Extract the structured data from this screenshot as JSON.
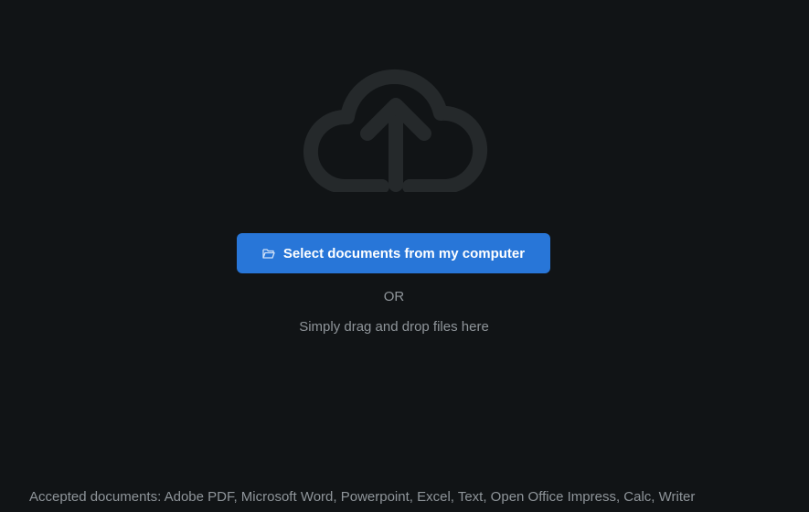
{
  "colors": {
    "background": "#111416",
    "icon": "#25292b",
    "button": "#2876d8",
    "button_text": "#ffffff",
    "muted_text": "#8f959a"
  },
  "icons": {
    "upload": "cloud-upload-icon",
    "folder": "folder-open-icon"
  },
  "upload": {
    "button_label": "Select documents from my computer",
    "or_label": "OR",
    "drag_hint": "Simply drag and drop files here",
    "accepted": "Accepted documents: Adobe PDF, Microsoft Word, Powerpoint, Excel, Text, Open Office Impress, Calc, Writer"
  }
}
